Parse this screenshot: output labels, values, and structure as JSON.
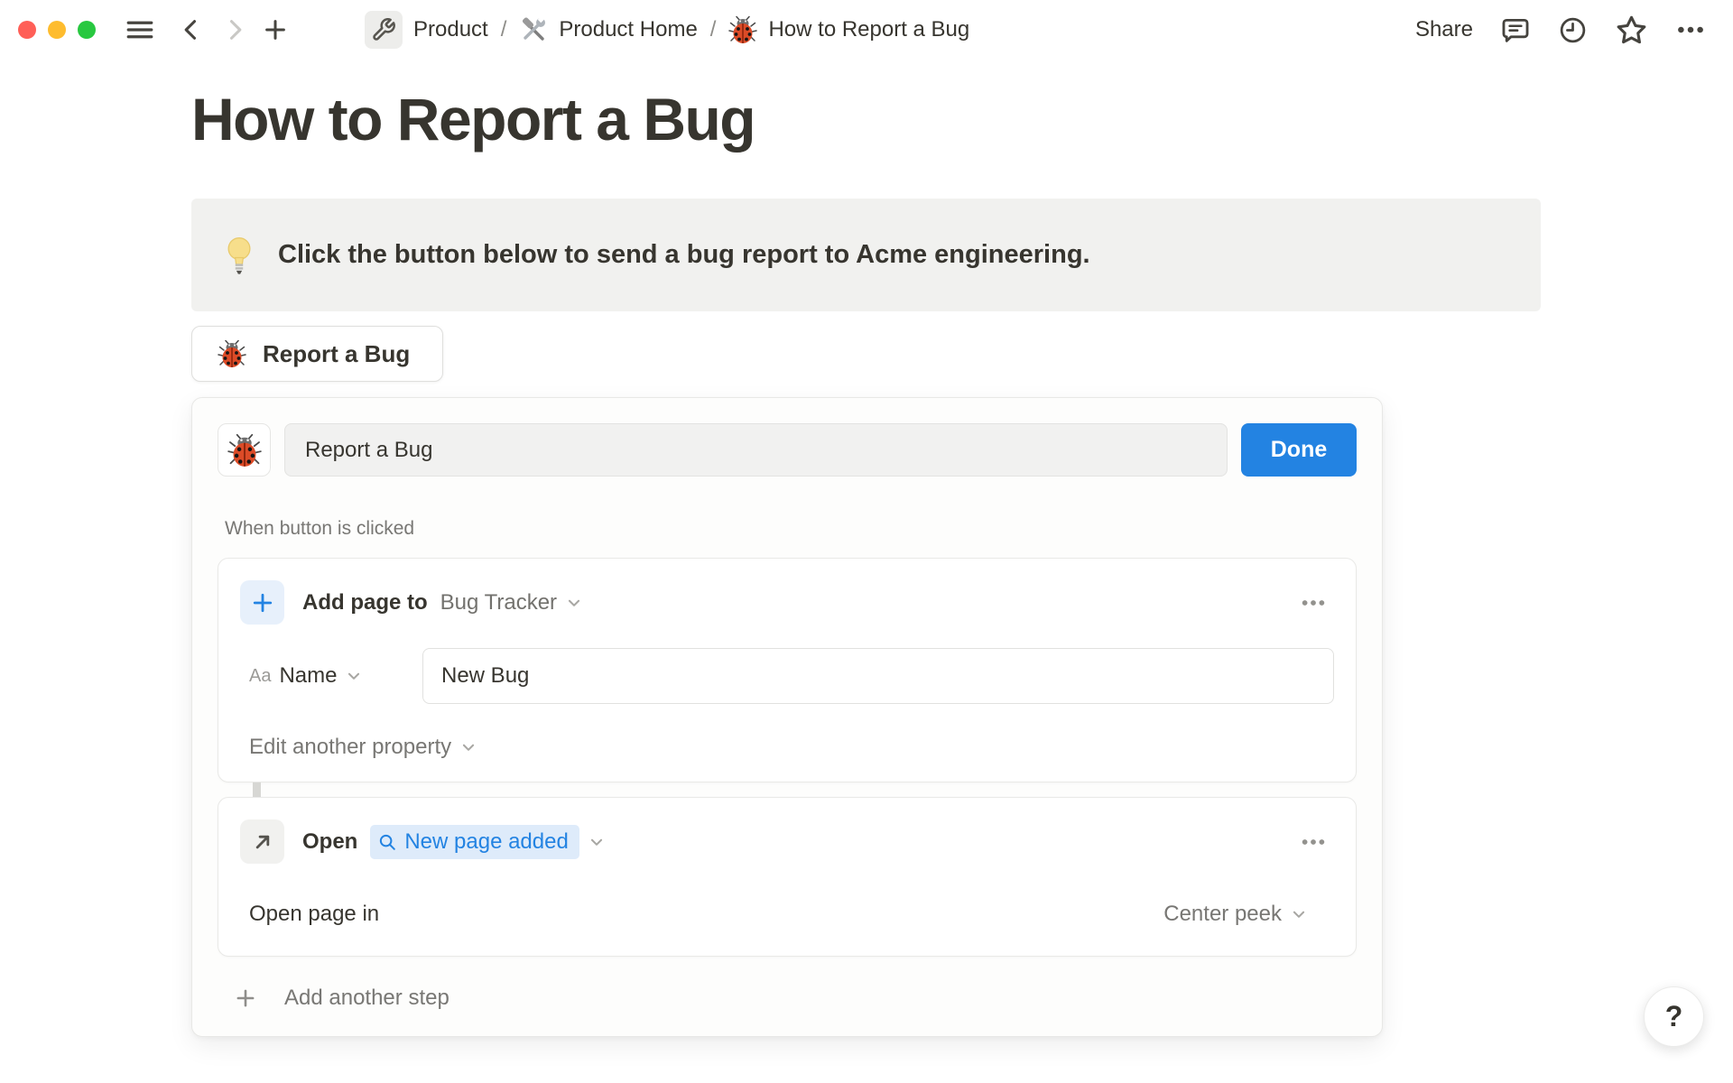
{
  "colors": {
    "accent_blue": "#2383E2",
    "traffic_close": "#FF5F57",
    "traffic_minimize": "#FEBC2E",
    "traffic_zoom": "#28C840",
    "callout_bg": "#F1F1EF",
    "text_dark": "#37352F",
    "text_gray": "#787774",
    "pill_bg": "#DEEBFA"
  },
  "icons": {
    "menu": "≡",
    "back": "‹",
    "forward": "›",
    "new-page": "+",
    "wrench": "🔧",
    "hammer-and-wrench": "🛠️",
    "ladybug": "🐞",
    "comment": "💬",
    "history-clock": "🕘",
    "star": "☆",
    "more-ellipsis": "•••",
    "light-bulb": "💡",
    "plus": "+",
    "open-arrow": "↗",
    "search": "🔍",
    "chevron-down": "⌄"
  },
  "toolbar": {
    "separator": "/",
    "breadcrumb": [
      {
        "icon": "wrench-icon",
        "label": "Product"
      },
      {
        "icon": "hammer-and-wrench-icon",
        "label": "Product Home"
      },
      {
        "icon": "ladybug-icon",
        "label": "How to Report a Bug"
      }
    ],
    "share_label": "Share"
  },
  "page": {
    "title": "How to Report a Bug",
    "callout_text": "Click the button below to send a bug report to Acme engineering.",
    "button_label": "Report a Bug"
  },
  "editor": {
    "button_name_value": "Report a Bug",
    "done_label": "Done",
    "trigger_label": "When button is clicked",
    "step1": {
      "action_label": "Add page to",
      "target_label": "Bug Tracker",
      "property_type_label": "Aa",
      "property_name": "Name",
      "property_value": "New Bug",
      "edit_another_label": "Edit another property"
    },
    "step2": {
      "action_label": "Open",
      "target_label": "New page added",
      "open_in_label": "Open page in",
      "open_mode_label": "Center peek"
    },
    "add_step_label": "Add another step"
  },
  "help": {
    "label": "?"
  }
}
